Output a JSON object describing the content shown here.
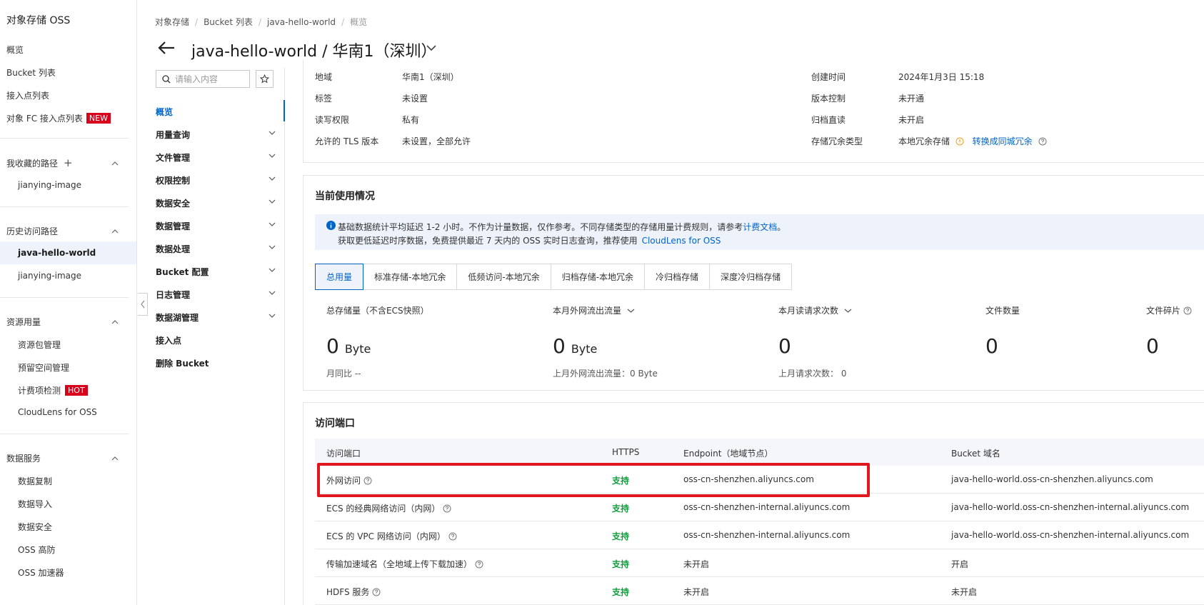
{
  "sidebar": {
    "title": "对象存储 OSS",
    "items": [
      {
        "label": "概览"
      },
      {
        "label": "Bucket 列表"
      },
      {
        "label": "接入点列表"
      },
      {
        "label": "对象 FC 接入点列表",
        "badge": "NEW"
      }
    ],
    "favorites": {
      "title": "我收藏的路径",
      "items": [
        "jianying-image"
      ]
    },
    "history": {
      "title": "历史访问路径",
      "items": [
        "java-hello-world",
        "jianying-image"
      ]
    },
    "resources": {
      "title": "资源用量",
      "items": [
        {
          "label": "资源包管理"
        },
        {
          "label": "预留空间管理"
        },
        {
          "label": "计费项检测",
          "badge": "HOT"
        },
        {
          "label": "CloudLens for OSS"
        }
      ]
    },
    "data_services": {
      "title": "数据服务",
      "items": [
        "数据复制",
        "数据导入",
        "数据安全",
        "OSS 高防",
        "OSS 加速器"
      ]
    }
  },
  "breadcrumb": [
    "对象存储",
    "Bucket 列表",
    "java-hello-world",
    "概览"
  ],
  "page_title": "java-hello-world / 华南1（深圳）",
  "subnav": {
    "search_placeholder": "请输入内容",
    "items": [
      {
        "label": "概览",
        "active": true,
        "chevron": false
      },
      {
        "label": "用量查询",
        "chevron": true
      },
      {
        "label": "文件管理",
        "chevron": true
      },
      {
        "label": "权限控制",
        "chevron": true
      },
      {
        "label": "数据安全",
        "chevron": true
      },
      {
        "label": "数据管理",
        "chevron": true
      },
      {
        "label": "数据处理",
        "chevron": true
      },
      {
        "label": "Bucket 配置",
        "chevron": true
      },
      {
        "label": "日志管理",
        "chevron": true
      },
      {
        "label": "数据湖管理",
        "chevron": true
      },
      {
        "label": "接入点",
        "chevron": false
      },
      {
        "label": "删除 Bucket",
        "chevron": false
      }
    ]
  },
  "basic_info": {
    "left": [
      {
        "label": "地域",
        "value": "华南1（深圳）"
      },
      {
        "label": "标签",
        "value": "未设置"
      },
      {
        "label": "读写权限",
        "value": "私有"
      },
      {
        "label": "允许的 TLS 版本",
        "value": "未设置，全部允许"
      }
    ],
    "right": [
      {
        "label": "创建时间",
        "value": "2024年1月3日 15:18"
      },
      {
        "label": "版本控制",
        "value": "未开通"
      },
      {
        "label": "归档直读",
        "value": "未开启"
      },
      {
        "label": "存储冗余类型",
        "value": "本地冗余存储"
      }
    ],
    "redundancy_link": "转换成同城冗余"
  },
  "usage": {
    "title": "当前使用情况",
    "notice_line1": "基础数据统计平均延迟 1-2 小时。不作为计量数据，仅作参考。不同存储类型的存储用量计费规则，请参考",
    "notice_link1": "计费文档",
    "notice_line1_end": "。",
    "notice_line2": "获取更低延迟时序数据，免费提供最近 7 天内的 OSS 实时日志查询，推荐使用",
    "notice_link2": "CloudLens for OSS",
    "tabs": [
      "总用量",
      "标准存储-本地冗余",
      "低频访问-本地冗余",
      "归档存储-本地冗余",
      "冷归档存储",
      "深度冷归档存储"
    ],
    "stats": [
      {
        "label": "总存储量（不含ECS快照）",
        "value": "0",
        "unit": "Byte",
        "sub": "月同比 --"
      },
      {
        "label": "本月外网流出流量",
        "value": "0",
        "unit": "Byte",
        "sub": "上月外网流出流量：0 Byte"
      },
      {
        "label": "本月读请求次数",
        "value": "0",
        "unit": "",
        "sub": "上月请求次数：  0"
      },
      {
        "label": "文件数量",
        "value": "0",
        "unit": "",
        "sub": ""
      },
      {
        "label": "文件碎片",
        "value": "0",
        "unit": "",
        "sub": ""
      }
    ]
  },
  "endpoints": {
    "title": "访问端口",
    "headers": [
      "访问端口",
      "HTTPS",
      "Endpoint（地域节点）",
      "Bucket 域名"
    ],
    "rows": [
      {
        "port": "外网访问",
        "https": "支持",
        "endpoint": "oss-cn-shenzhen.aliyuncs.com",
        "domain": "java-hello-world.oss-cn-shenzhen.aliyuncs.com"
      },
      {
        "port": "ECS 的经典网络访问（内网）",
        "https": "支持",
        "endpoint": "oss-cn-shenzhen-internal.aliyuncs.com",
        "domain": "java-hello-world.oss-cn-shenzhen-internal.aliyuncs.com"
      },
      {
        "port": "ECS 的 VPC 网络访问（内网）",
        "https": "支持",
        "endpoint": "oss-cn-shenzhen-internal.aliyuncs.com",
        "domain": "java-hello-world.oss-cn-shenzhen-internal.aliyuncs.com"
      },
      {
        "port": "传输加速域名（全地域上传下载加速）",
        "https": "支持",
        "endpoint": "未开启",
        "domain": "开启"
      },
      {
        "port": "HDFS 服务",
        "https": "支持",
        "endpoint": "未开启",
        "domain": "未开启"
      }
    ]
  },
  "colors": {
    "accent": "#0064c8",
    "badge": "#d9001b",
    "success": "#0f9d3c",
    "highlight": "#e0181e"
  }
}
